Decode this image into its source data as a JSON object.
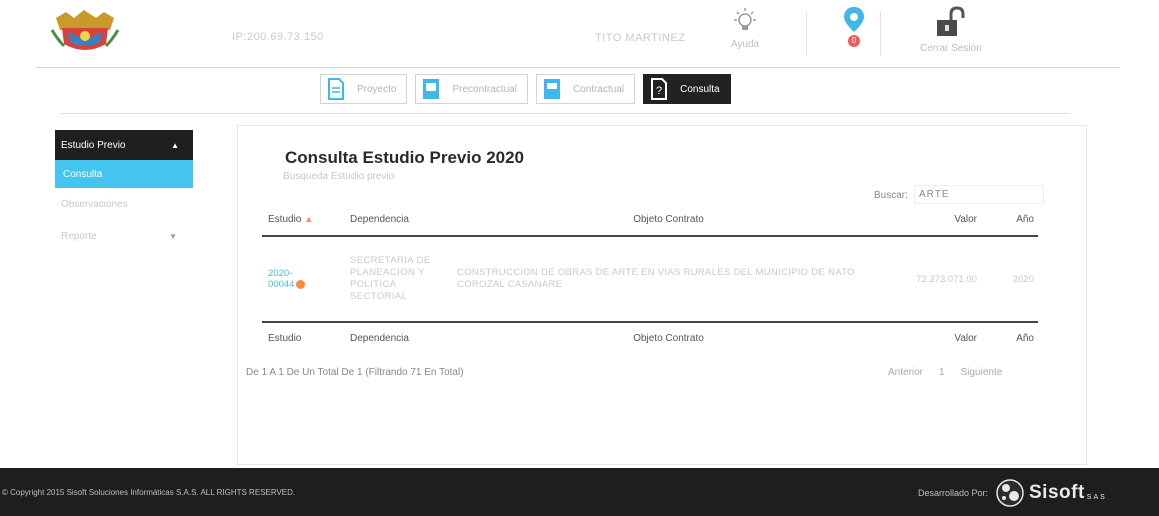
{
  "header": {
    "ip": "IP:200.69.73.150",
    "user": "TITO MARTINEZ",
    "help_label": "Ayuda",
    "notifications_count": "0",
    "logout_label": "Cerrar Sesión"
  },
  "tabs": [
    {
      "label": "Proyecto"
    },
    {
      "label": "Precontractual"
    },
    {
      "label": "Contractual"
    },
    {
      "label": "Consulta"
    }
  ],
  "sidebar": {
    "header": "Estudio Previo",
    "items": [
      {
        "label": "Consulta"
      },
      {
        "label": "Observaciones"
      },
      {
        "label": "Reporte"
      }
    ]
  },
  "main": {
    "title": "Consulta Estudio Previo 2020",
    "subtitle": "Busqueda Estudio previo",
    "search_label": "Buscar:",
    "search_value": "ARTE",
    "columns": [
      "Estudio",
      "Dependencia",
      "Objeto Contrato",
      "Valor",
      "Año"
    ],
    "rows": [
      {
        "estudio_line1": "2020-",
        "estudio_line2": "00044",
        "dependencia": "SECRETARIA DE PLANEACION Y POLITICA SECTORIAL",
        "objeto": "CONSTRUCCION DE OBRAS DE ARTE EN VIAS RURALES DEL MUNICIPIO DE NATO COROZAL CASANARE",
        "valor": "72.273.071.00",
        "ano": "2020"
      }
    ],
    "info": "De 1 A 1 De Un Total De 1 (Filtrando 71 En Total)",
    "pager": {
      "prev": "Anterior",
      "page": "1",
      "next": "Siguiente"
    }
  },
  "footer": {
    "copyright": "© Copyright 2015 Sisoft Soluciones Informáticas S.A.S. ALL RIGHTS RESERVED.",
    "developed_by": "Desarrollado Por:",
    "brand": "Sisoft",
    "brand_suffix": "SAS"
  },
  "colors": {
    "accent": "#44c5f0",
    "dark": "#1f1f1f",
    "badge": "#ff8a3d"
  }
}
